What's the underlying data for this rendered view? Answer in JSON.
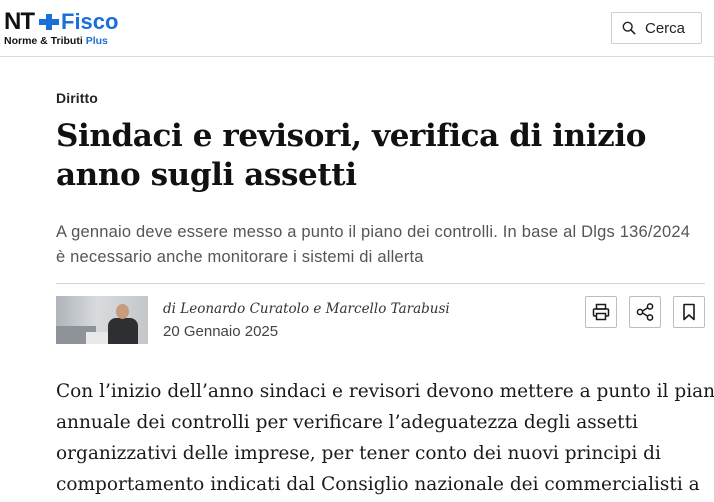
{
  "header": {
    "logo": {
      "brand_short": "NT",
      "brand_name": "Fisco",
      "subtitle": "Norme & Tributi",
      "subtitle_plus": "Plus",
      "accent_color": "#1a6fd8"
    },
    "search": {
      "label": "Cerca",
      "icon": "search-icon"
    }
  },
  "article": {
    "section": "Diritto",
    "title": "Sindaci e revisori, verifica di inizio anno sugli assetti",
    "summary": "A gennaio deve essere messo a punto il piano dei controlli. In base al Dlgs 136/2024 è necessario anche monitorare i sistemi di allerta",
    "byline": "di Leonardo Curatolo e Marcello Tarabusi",
    "date": "20 Gennaio 2025",
    "actions": [
      {
        "name": "print",
        "icon": "printer-icon"
      },
      {
        "name": "share",
        "icon": "share-icon"
      },
      {
        "name": "bookmark",
        "icon": "bookmark-icon"
      }
    ],
    "body_lines": [
      "Con l’inizio dell’anno sindaci e revisori devono mettere a punto il piano",
      "annuale dei controlli per verificare l’adeguatezza degli assetti",
      "organizzativi delle imprese, per tener conto dei nuovi principi di",
      "comportamento indicati dal Consiglio nazionale dei commercialisti a"
    ]
  }
}
